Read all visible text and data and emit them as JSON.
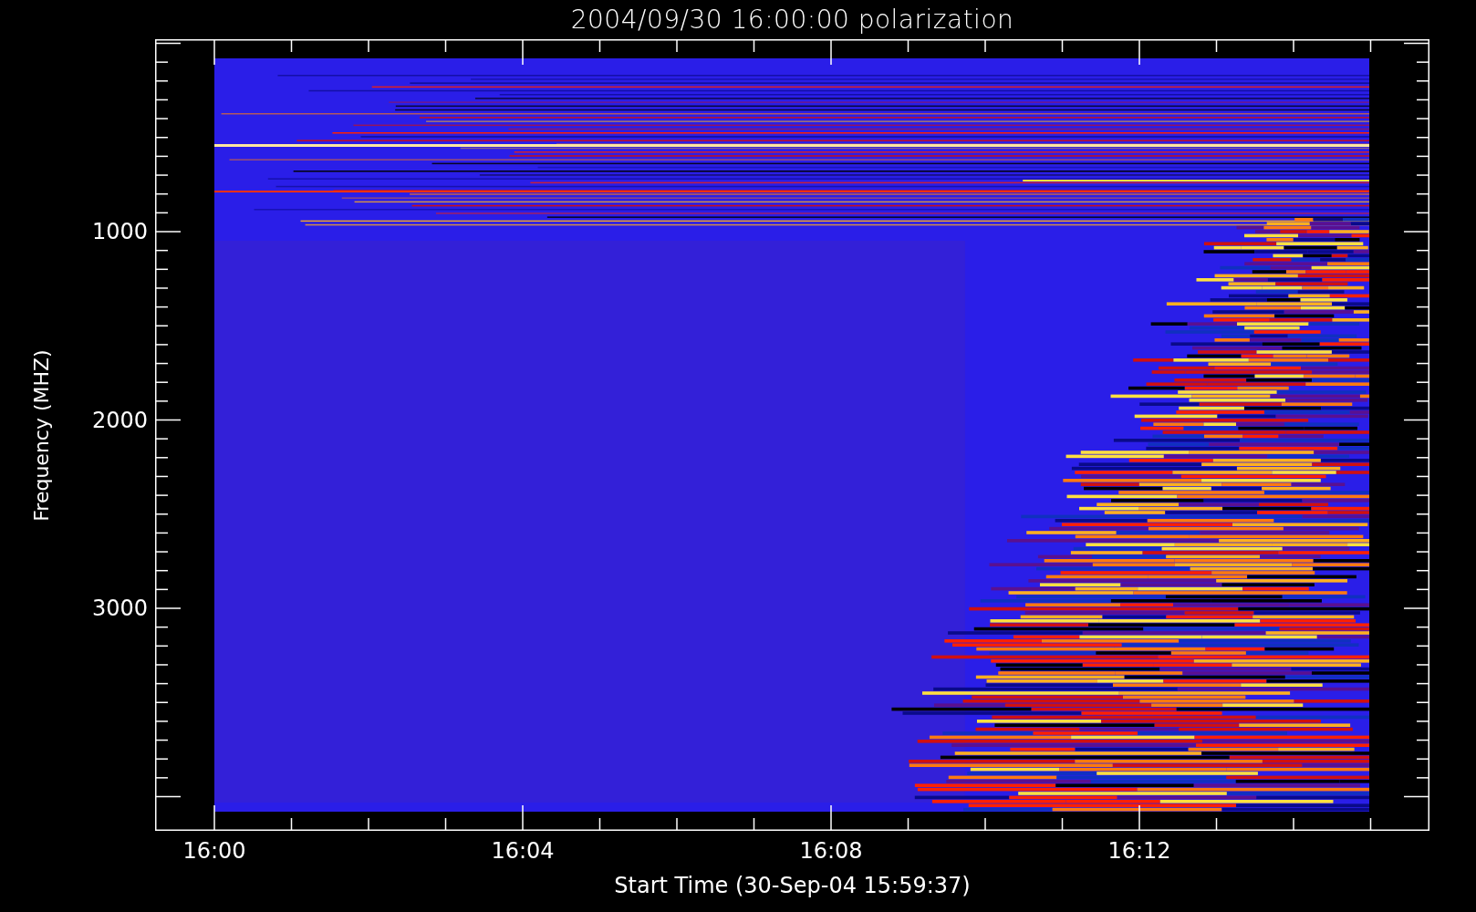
{
  "plot": {
    "title": "2004/09/30 16:00:00 polarization",
    "ylabel": "Frequency (MHZ)",
    "xlabel": "Start Time (30-Sep-04 15:59:37)",
    "yticks": [
      "1000",
      "2000",
      "3000"
    ],
    "xticks": [
      "16:00",
      "16:04",
      "16:08",
      "16:12"
    ]
  }
}
